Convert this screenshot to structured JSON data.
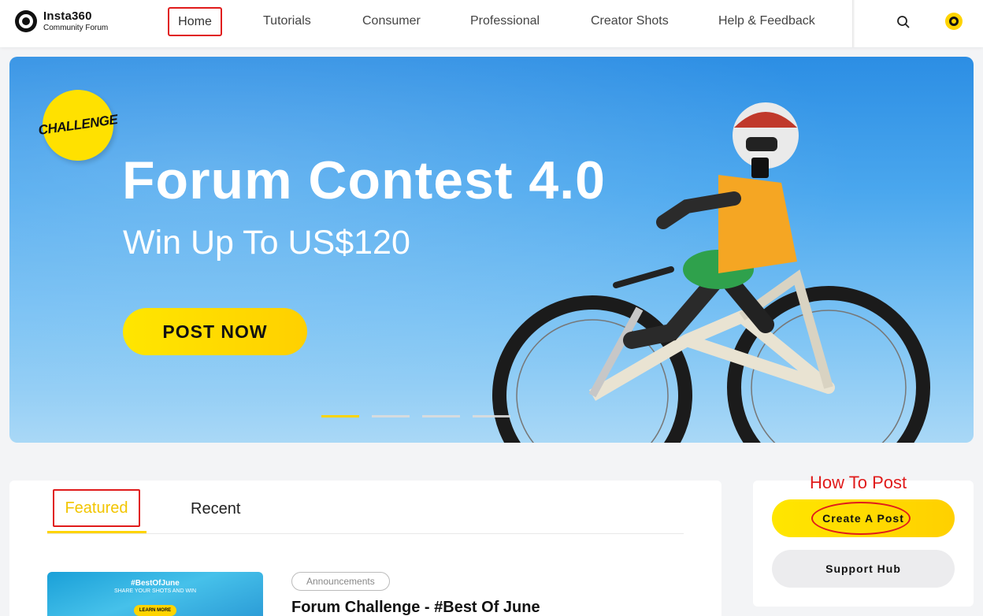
{
  "brand": {
    "name": "Insta360",
    "subtitle": "Community Forum"
  },
  "nav": {
    "items": [
      {
        "label": "Home",
        "active": true
      },
      {
        "label": "Tutorials"
      },
      {
        "label": "Consumer"
      },
      {
        "label": "Professional"
      },
      {
        "label": "Creator Shots"
      },
      {
        "label": "Help & Feedback"
      }
    ],
    "search_icon": "search-icon",
    "avatar_icon": "user-avatar-icon"
  },
  "banner": {
    "badge": "CHALLENGE",
    "title": "Forum Contest 4.0",
    "subtitle": "Win Up To US$120",
    "cta": "POST NOW",
    "slide_count": 4,
    "active_slide": 1
  },
  "feed": {
    "tabs": [
      {
        "label": "Featured",
        "active": true
      },
      {
        "label": "Recent"
      }
    ],
    "posts": [
      {
        "thumb_title": "#BestOfJune",
        "thumb_subtitle": "SHARE YOUR SHOTS AND WIN",
        "thumb_button": "LEARN MORE",
        "tag": "Announcements",
        "title": "Forum Challenge - #Best Of June"
      }
    ]
  },
  "sidebar": {
    "annotation": "How To Post",
    "create_button": "Create A Post",
    "support_button": "Support Hub"
  },
  "colors": {
    "accent": "#ffd400",
    "annotation_red": "#e01b1b",
    "banner_sky": "#4aa7ee"
  }
}
